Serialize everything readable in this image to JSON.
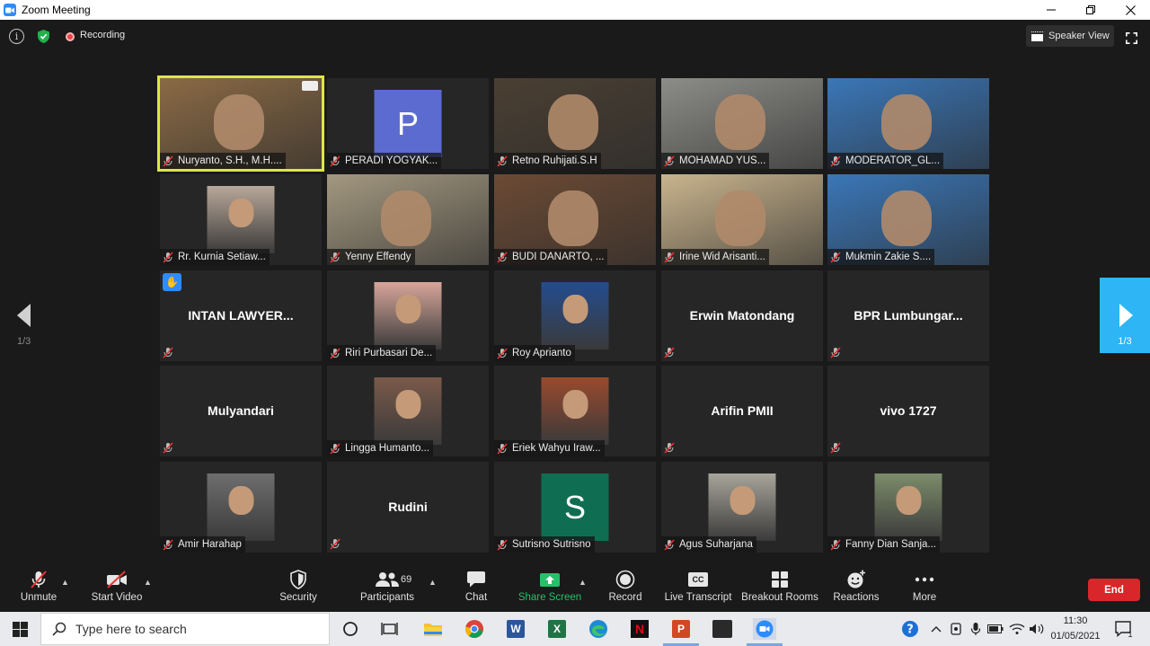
{
  "window": {
    "title": "Zoom Meeting"
  },
  "topbar": {
    "recording_label": "Recording",
    "view_label": "Speaker View"
  },
  "pagination": {
    "left": "1/3",
    "right": "1/3"
  },
  "participants": [
    {
      "name": "Nuryanto, S.H., M.H....",
      "kind": "video",
      "active": true,
      "color": "#8a6a45"
    },
    {
      "name": "PERADI YOGYAK...",
      "kind": "letter",
      "letter": "P",
      "color": "#5b6bd0"
    },
    {
      "name": "Retno Ruhijati.S.H",
      "kind": "video",
      "color": "#4a3f33"
    },
    {
      "name": "MOHAMAD YUS...",
      "kind": "video",
      "color": "#8c8c88"
    },
    {
      "name": "MODERATOR_GL...",
      "kind": "video",
      "color": "#3a77b8"
    },
    {
      "name": "Rr. Kurnia Setiaw... ",
      "kind": "avatar",
      "color": "#b9a89a"
    },
    {
      "name": "Yenny Effendy",
      "kind": "video",
      "color": "#a39880"
    },
    {
      "name": "BUDI DANARTO, ...",
      "kind": "video",
      "color": "#6b4a34"
    },
    {
      "name": "Irine Wid Arisanti...",
      "kind": "video",
      "color": "#c9b48d"
    },
    {
      "name": "Mukmin Zakie S....",
      "kind": "video",
      "color": "#3a77b8"
    },
    {
      "name": "INTAN LAWYER...",
      "kind": "text",
      "hand": true
    },
    {
      "name": "Riri Purbasari De...",
      "kind": "avatar",
      "color": "#d7a69a"
    },
    {
      "name": "Roy Aprianto",
      "kind": "avatar",
      "color": "#244c8f"
    },
    {
      "name": "Erwin Matondang",
      "kind": "text"
    },
    {
      "name": "BPR  Lumbungar...",
      "kind": "text"
    },
    {
      "name": "Mulyandari",
      "kind": "text"
    },
    {
      "name": "Lingga Humanto...",
      "kind": "avatar",
      "color": "#7a5a4a"
    },
    {
      "name": "Eriek Wahyu Iraw...",
      "kind": "avatar",
      "color": "#9a4a2e"
    },
    {
      "name": "Arifin PMII",
      "kind": "text"
    },
    {
      "name": "vivo 1727",
      "kind": "text"
    },
    {
      "name": "Amir Harahap",
      "kind": "avatar",
      "color": "#6e6e6e"
    },
    {
      "name": "Rudini",
      "kind": "text"
    },
    {
      "name": "Sutrisno Sutrisno",
      "kind": "letter",
      "letter": "S",
      "color": "#0f6e52"
    },
    {
      "name": "Agus Suharjana",
      "kind": "avatar",
      "color": "#a8a59a"
    },
    {
      "name": "Fanny Dian Sanja...",
      "kind": "avatar",
      "color": "#7c8c6a"
    }
  ],
  "toolbar": {
    "unmute": "Unmute",
    "start_video": "Start Video",
    "security": "Security",
    "participants": "Participants",
    "participants_count": "69",
    "chat": "Chat",
    "share_screen": "Share Screen",
    "record": "Record",
    "live_transcript": "Live Transcript",
    "cc_badge": "CC",
    "breakout_rooms": "Breakout Rooms",
    "reactions": "Reactions",
    "more": "More",
    "end": "End"
  },
  "taskbar": {
    "search_placeholder": "Type here to search",
    "time": "11:30",
    "date": "01/05/2021",
    "notification_count": "1",
    "app_word_letter": "W",
    "app_excel_letter": "X",
    "app_netflix_letter": "N",
    "app_powerpoint_letter": "P"
  },
  "colors": {
    "accent_blue": "#2d8cff",
    "end_red": "#d9262b",
    "share_green": "#27c06a",
    "active_border": "#dce64a"
  }
}
